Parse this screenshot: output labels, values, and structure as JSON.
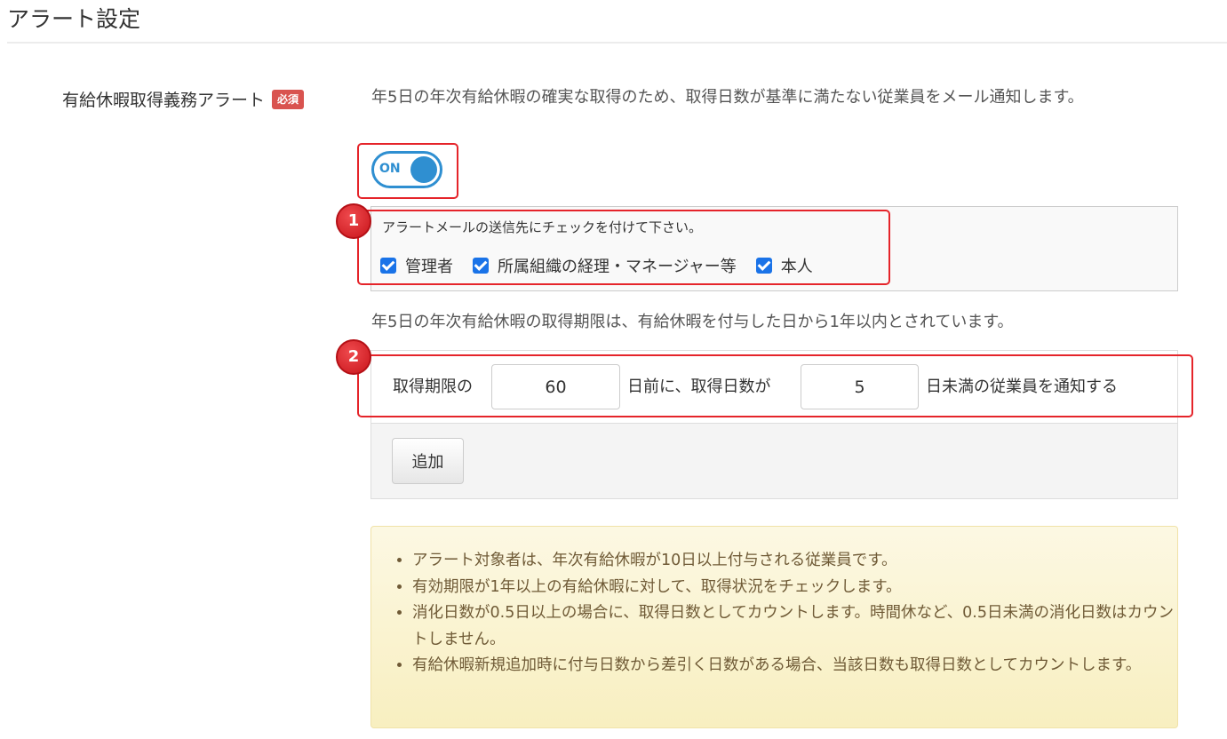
{
  "page": {
    "title": "アラート設定"
  },
  "field": {
    "label": "有給休暇取得義務アラート",
    "required_badge": "必須",
    "description": "年5日の年次有給休暇の確実な取得のため、取得日数が基準に満たない従業員をメール通知します。",
    "toggle": {
      "label": "ON",
      "state": "on"
    }
  },
  "recipients": {
    "instruction": "アラートメールの送信先にチェックを付けて下さい。",
    "options": [
      {
        "label": "管理者",
        "checked": true
      },
      {
        "label": "所属組織の経理・マネージャー等",
        "checked": true
      },
      {
        "label": "本人",
        "checked": true
      }
    ]
  },
  "deadline_note": "年5日の年次有給休暇の取得期限は、有給休暇を付与した日から1年以内とされています。",
  "deadline_rule": {
    "text_before_days": "取得期限の",
    "days_before_value": "60",
    "text_middle": "日前に、取得日数が",
    "min_days_value": "5",
    "text_after": "日未満の従業員を通知する"
  },
  "add_button": {
    "label": "追加"
  },
  "notes": [
    "アラート対象者は、年次有給休暇が10日以上付与される従業員です。",
    "有効期限が1年以上の有給休暇に対して、取得状況をチェックします。",
    "消化日数が0.5日以上の場合に、取得日数としてカウントします。時間休など、0.5日未満の消化日数はカウントしません。",
    "有給休暇新規追加時に付与日数から差引く日数がある場合、当該日数も取得日数としてカウントします。"
  ],
  "annotations": {
    "step1": "1",
    "step2": "2"
  },
  "colors": {
    "accent": "#2f8fd1",
    "required": "#d9534f",
    "highlight": "#e5242a",
    "note_bg": "#fcf8e3",
    "checkbox": "#1a73e8"
  }
}
